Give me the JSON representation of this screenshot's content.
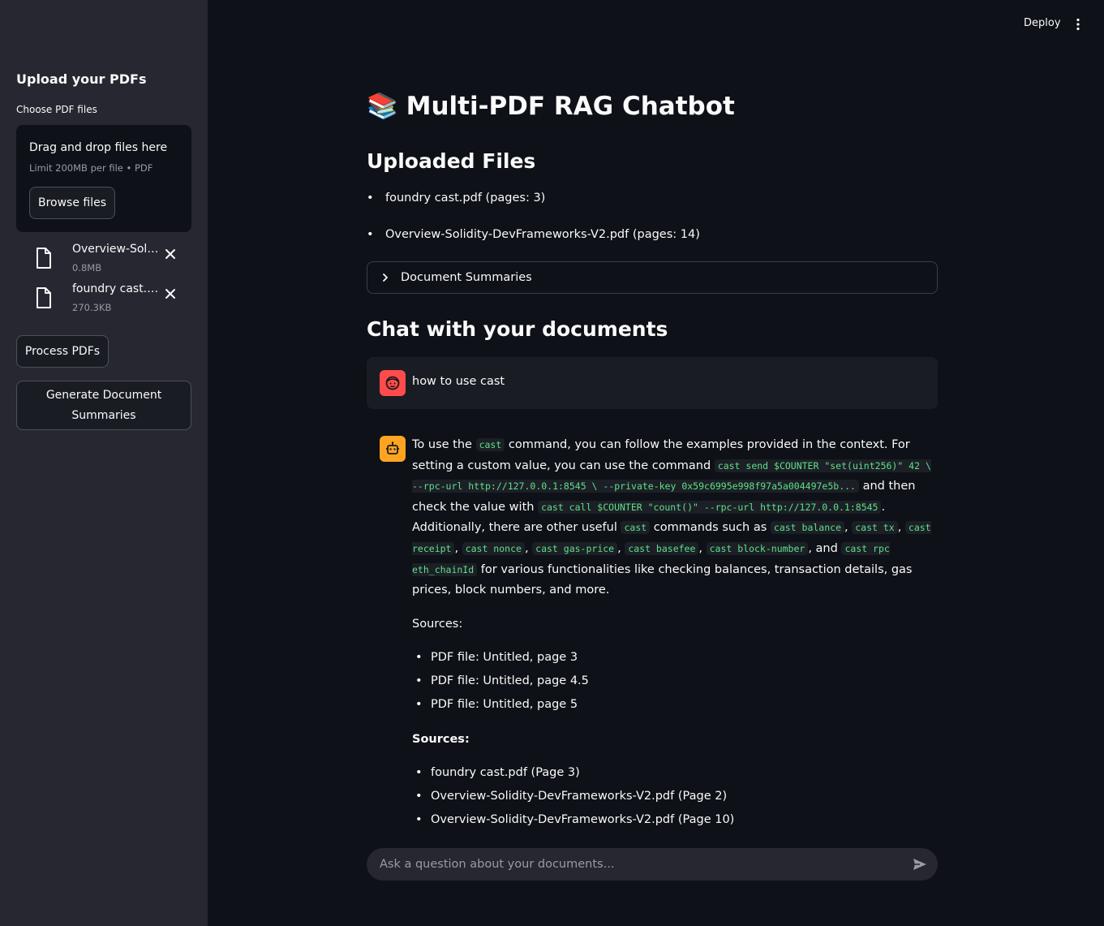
{
  "sidebar": {
    "title": "Upload your PDFs",
    "uploader_label": "Choose PDF files",
    "dropzone_title": "Drag and drop files here",
    "dropzone_sub": "Limit 200MB per file • PDF",
    "browse_label": "Browse files",
    "files": [
      {
        "name": "Overview-Solidity-DevFrameworks-V2.pdf",
        "size": "0.8MB"
      },
      {
        "name": "foundry cast.pdf",
        "size": "270.3KB"
      }
    ],
    "process_label": "Process PDFs",
    "summaries_label": "Generate Document Summaries"
  },
  "topbar": {
    "deploy_label": "Deploy"
  },
  "main": {
    "title_emoji": "📚",
    "title": "Multi-PDF RAG Chatbot",
    "uploaded_heading": "Uploaded Files",
    "uploaded_files": [
      "foundry cast.pdf (pages: 3)",
      "Overview-Solidity-DevFrameworks-V2.pdf (pages: 14)"
    ],
    "expander_label": "Document Summaries",
    "chat_heading": "Chat with your documents",
    "user_message": "how to use cast",
    "bot": {
      "t1": "To use the ",
      "c1": "cast",
      "t2": " command, you can follow the examples provided in the context. For setting a custom value, you can use the command ",
      "c2": "cast send $COUNTER \"set(uint256)\" 42 \\ --rpc-url http://127.0.0.1:8545 \\ --private-key 0x59c6995e998f97a5a004497e5b...",
      "t3": " and then check the value with ",
      "c3": "cast call $COUNTER \"count()\" --rpc-url http://127.0.0.1:8545",
      "t4": ". Additionally, there are other useful ",
      "c4": "cast",
      "t5": " commands such as ",
      "c5": "cast balance",
      "s1": ", ",
      "c6": "cast tx",
      "s2": ", ",
      "c7": "cast receipt",
      "s3": ", ",
      "c8": "cast nonce",
      "s4": ", ",
      "c9": "cast gas-price",
      "s5": ", ",
      "c10": "cast basefee",
      "s6": ", ",
      "c11": "cast block-number",
      "s7": ", and ",
      "c12": "cast rpc eth_chainId",
      "t6": " for various functionalities like checking balances, transaction details, gas prices, block numbers, and more.",
      "sources1_label": "Sources:",
      "sources1": [
        "PDF file: Untitled, page 3",
        "PDF file: Untitled, page 4.5",
        "PDF file: Untitled, page 5"
      ],
      "sources2_label": "Sources:",
      "sources2": [
        "foundry cast.pdf (Page 3)",
        "Overview-Solidity-DevFrameworks-V2.pdf (Page 2)",
        "Overview-Solidity-DevFrameworks-V2.pdf (Page 10)"
      ]
    },
    "chat_placeholder": "Ask a question about your documents..."
  },
  "colors": {
    "background": "#0e1117",
    "sidebar": "#262730",
    "user_avatar": "#ff4b4b",
    "bot_avatar": "#ffa421",
    "code_text": "#5ee08a"
  }
}
